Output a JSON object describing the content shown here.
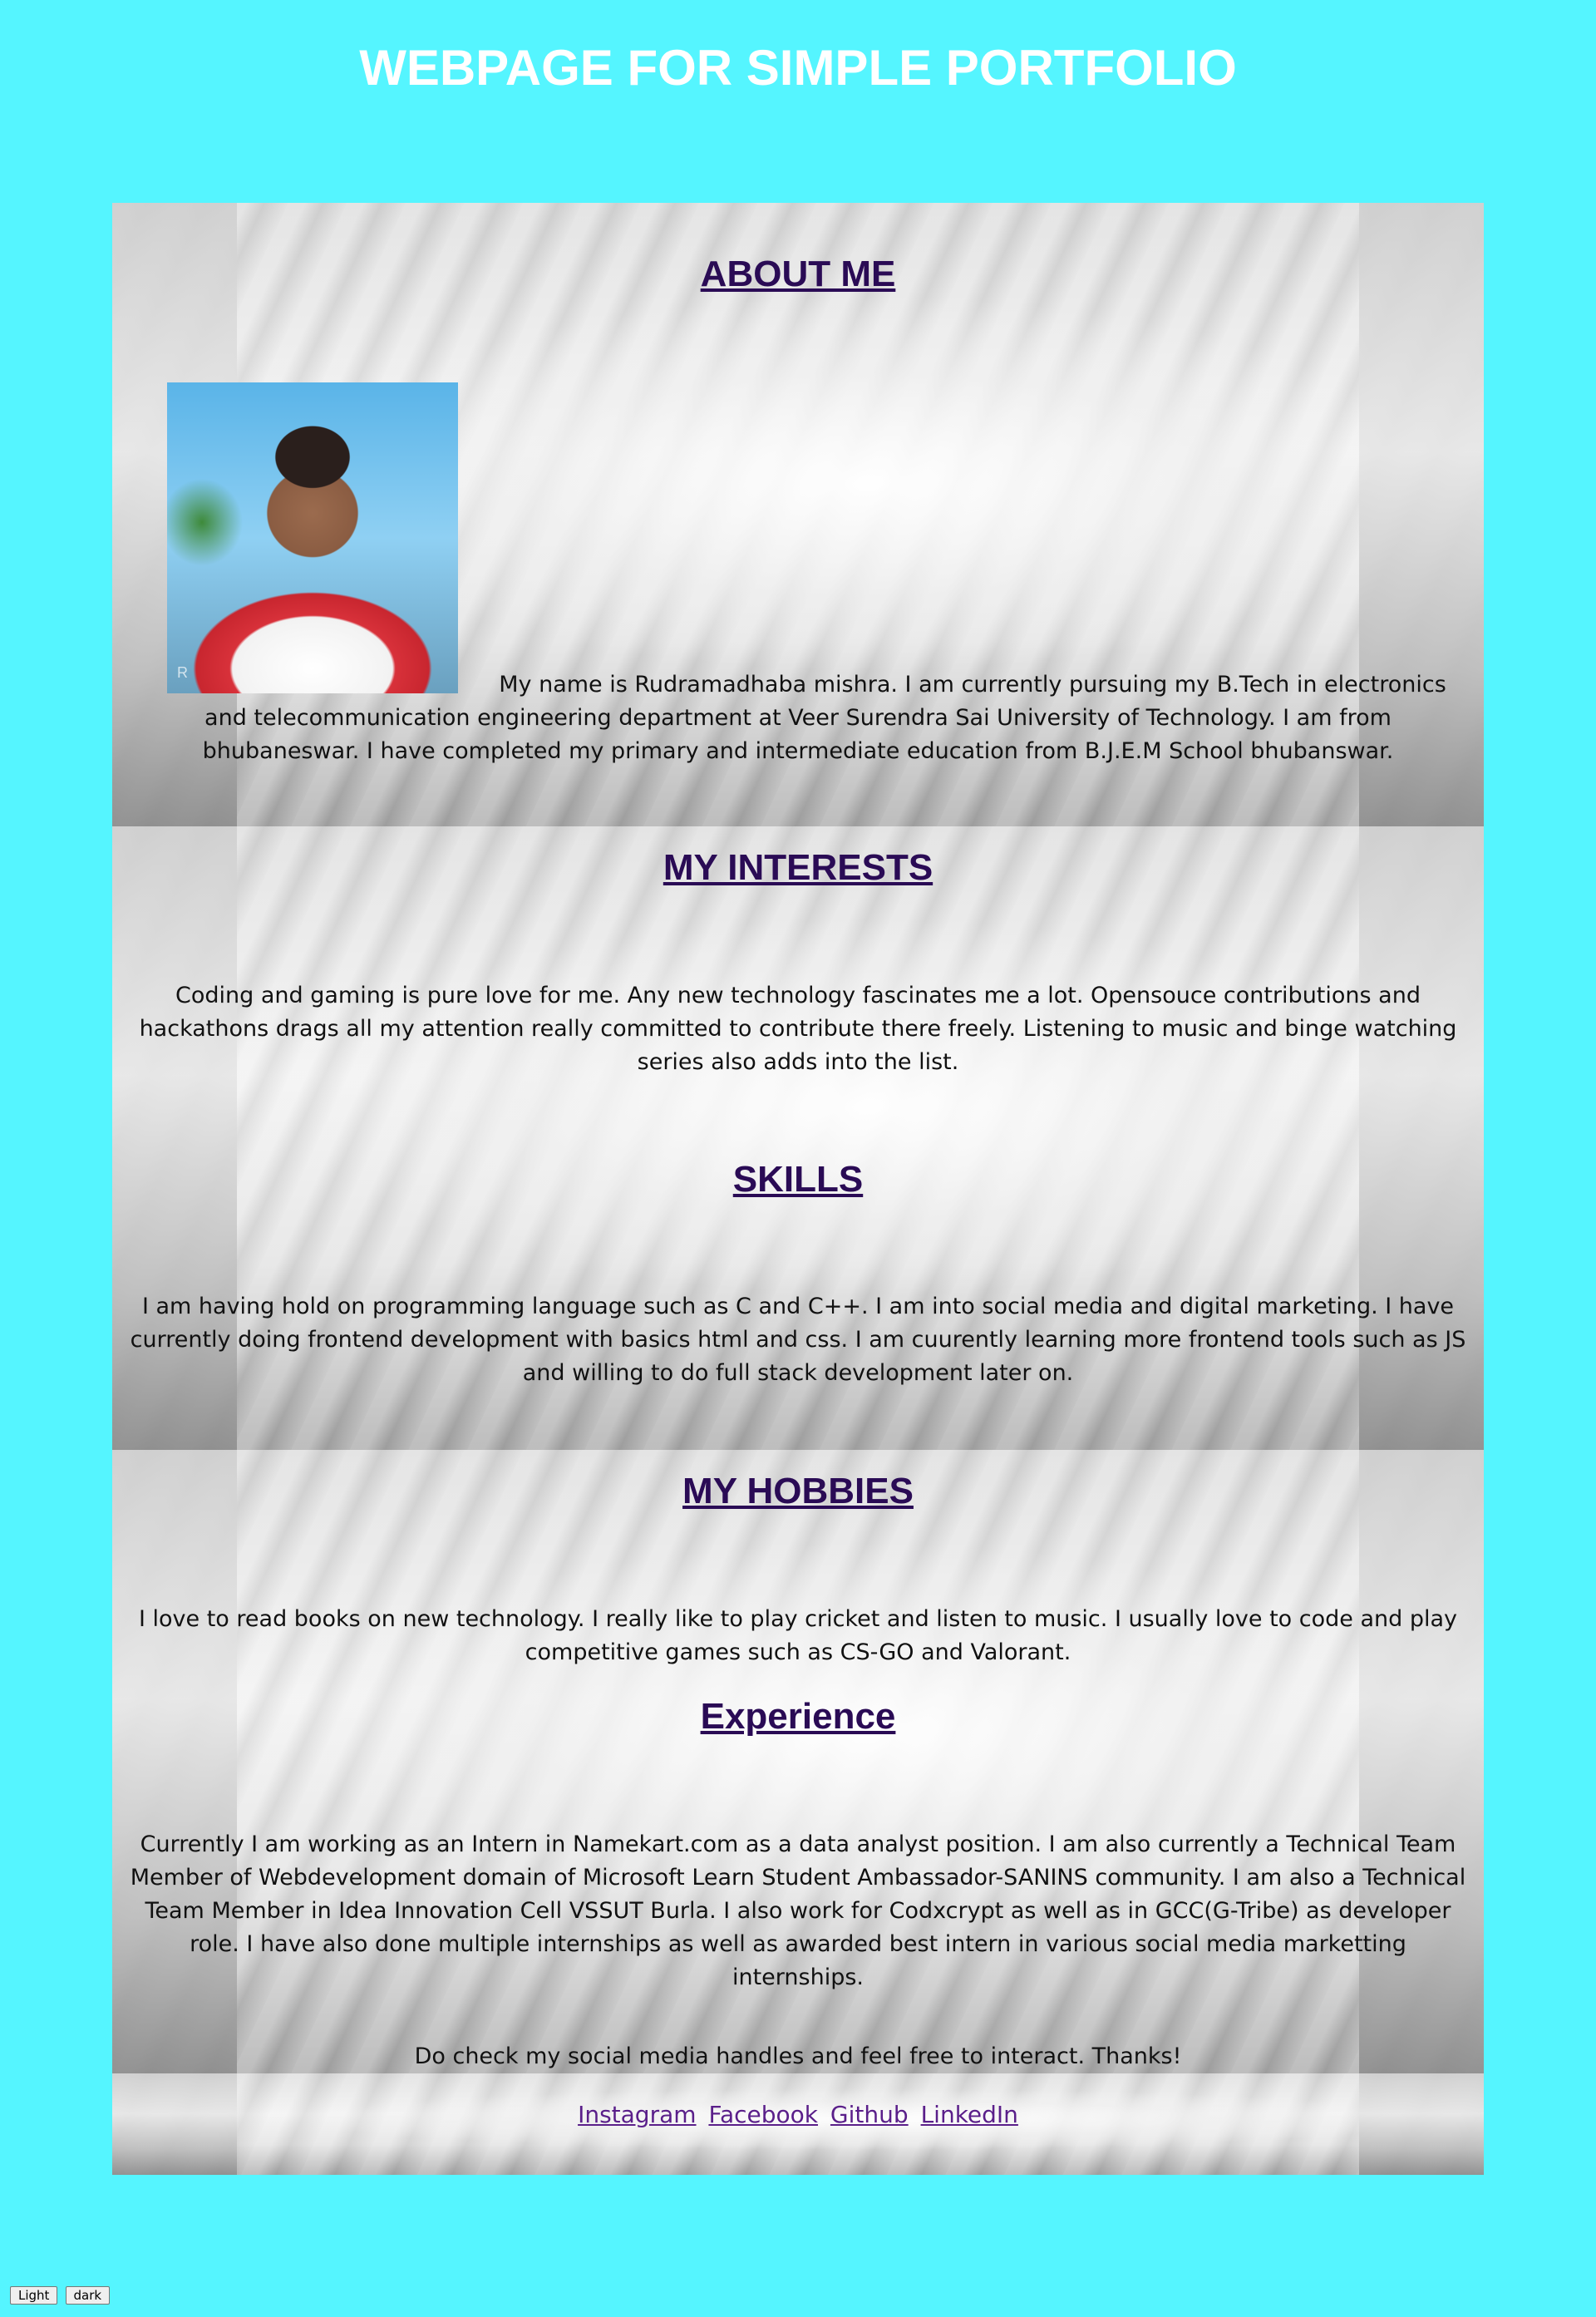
{
  "page_title": "WEBPAGE FOR SIMPLE PORTFOLIO",
  "about": {
    "heading": "ABOUT ME",
    "text": "My name is Rudramadhaba mishra. I am currently pursuing my B.Tech in electronics and telecommunication engineering department at Veer Surendra Sai University of Technology. I am from bhubaneswar. I have completed my primary and intermediate education from B.J.E.M School bhubanswar.",
    "photo_watermark": "R"
  },
  "interests": {
    "heading": "MY INTERESTS",
    "text": "Coding and gaming is pure love for me. Any new technology fascinates me a lot. Opensouce contributions and hackathons drags all my attention really committed to contribute there freely. Listening to music and binge watching series also adds into the list."
  },
  "skills": {
    "heading": "SKILLS",
    "text": "I am having hold on programming language such as C and C++. I am into social media and digital marketing. I have currently doing frontend development with basics html and css. I am cuurently learning more frontend tools such as JS and willing to do full stack development later on."
  },
  "hobbies": {
    "heading": "MY HOBBIES",
    "text": "I love to read books on new technology. I really like to play cricket and listen to music. I usually love to code and play competitive games such as CS-GO and Valorant."
  },
  "experience": {
    "heading": "Experience",
    "text": "Currently I am working as an Intern in Namekart.com as a data analyst position. I am also currently a Technical Team Member of Webdevelopment domain of Microsoft Learn Student Ambassador-SANINS community. I am also a Technical Team Member in Idea Innovation Cell VSSUT Burla. I also work for Codxcrypt as well as in GCC(G-Tribe) as developer role. I have also done multiple internships as well as awarded best intern in various social media marketting internships.",
    "closing": "Do check my social media handles and feel free to interact. Thanks!"
  },
  "footer": {
    "links": [
      "Instagram",
      "Facebook",
      "Github",
      "LinkedIn"
    ],
    "link_color": "#5a1f8a"
  },
  "theme_buttons": {
    "light": "Light",
    "dark": "dark"
  },
  "colors": {
    "background": "#55f5ff",
    "heading": "#2a0b55",
    "title": "#ffffff"
  }
}
